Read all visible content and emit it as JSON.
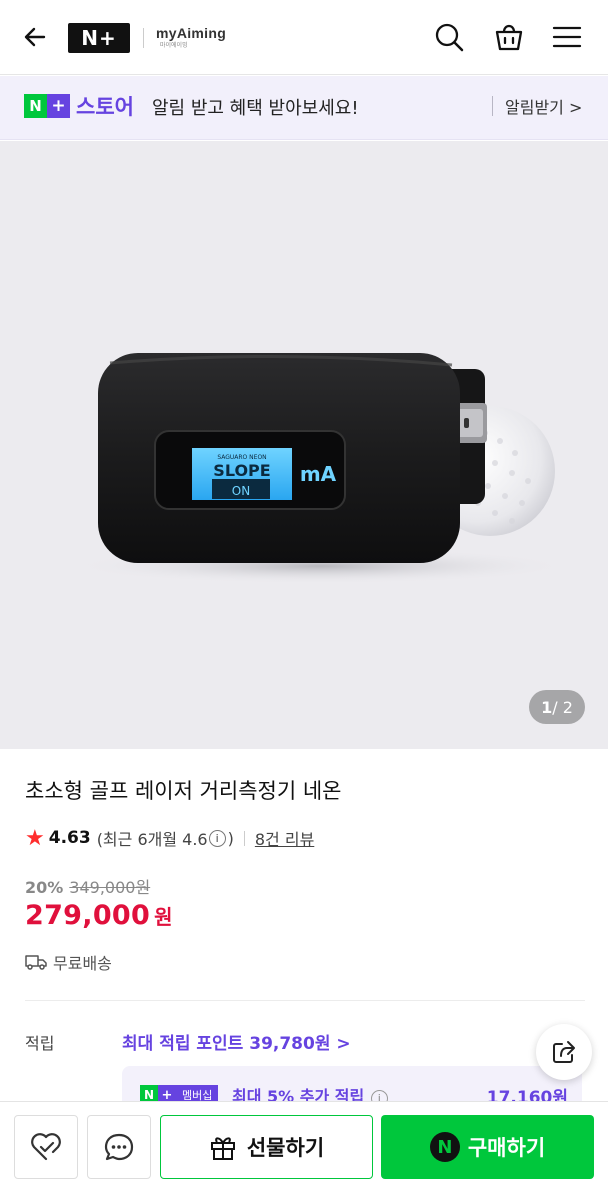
{
  "header": {
    "logo_text": "N+",
    "brand_name": "myAiming",
    "brand_sub": "마이에이밍",
    "icons": [
      "back-arrow-icon",
      "search-icon",
      "shopping-bag-icon",
      "menu-icon"
    ]
  },
  "banner": {
    "badge_n": "N",
    "badge_plus": "+",
    "store_label": "스토어",
    "message": "알림 받고 혜택 받아보세요!",
    "link": "알림받기 >"
  },
  "hero": {
    "device_screen_top": "SAGUARO NEON",
    "device_screen_main": "SLOPE",
    "device_screen_on": "ON",
    "device_logo": "mA",
    "counter_current": "1",
    "counter_total": " / 2"
  },
  "product": {
    "title": "초소형 골프 레이저 거리측정기 네온",
    "rating": "4.63",
    "recent_rating_prefix": "(최근 6개월 4.6",
    "recent_rating_suffix": ")",
    "review_count": "8건 리뷰",
    "discount_pct": "20%",
    "original_price": "349,000원",
    "price": "279,000",
    "price_unit": "원",
    "shipping": "무료배송"
  },
  "points": {
    "label": "적립",
    "max_points": "최대 적립 포인트 39,780원 >",
    "member_badge_n": "N",
    "member_badge_plus": "+",
    "member_badge_label": "멤버십",
    "member_text": "최대 5% 추가 적립",
    "member_amount": "17,160원"
  },
  "bottom": {
    "gift_label": "선물하기",
    "buy_label": "구매하기",
    "npay_mark": "N"
  },
  "colors": {
    "npay_green": "#00c73c",
    "plus_purple": "#6643e0",
    "price_red": "#e0103c",
    "star_red": "#ff2d2d"
  }
}
